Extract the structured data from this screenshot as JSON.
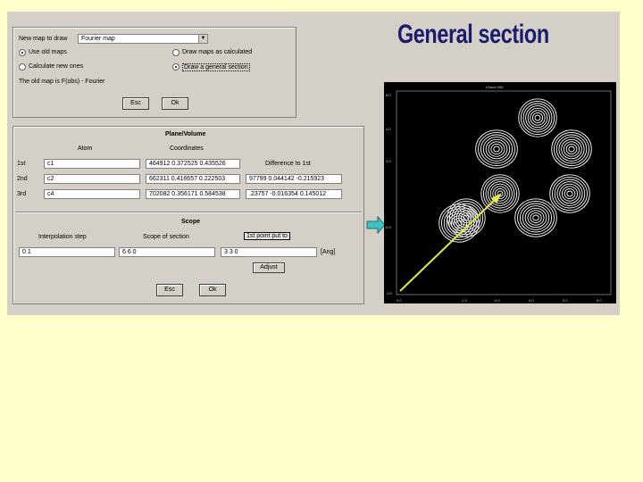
{
  "headline": "General section",
  "map_dialog": {
    "new_map_label": "New map to draw",
    "map_type_value": "Fourier map",
    "use_old_maps": "Use old maps",
    "draw_as_calculated": "Draw maps as calculated",
    "calculate_new": "Calculate new ones",
    "draw_general_section": "Draw a general section",
    "old_map_info": "The old map is F(obs) - Fourier",
    "esc_label": "Esc",
    "ok_label": "Ok"
  },
  "plane_dialog": {
    "title": "Plane/Volume",
    "atom_header": "Atom",
    "coord_header": "Coordinates",
    "diff_header": "Difference to 1st",
    "rows": [
      {
        "label": "1st",
        "atom": "c1",
        "coords": "464912 0.372525 0.435526",
        "diff": ""
      },
      {
        "label": "2nd",
        "atom": "c2",
        "coords": "662311 0.416657 0.222503",
        "diff": "97799 0.044142 -0.215923"
      },
      {
        "label": "3rd",
        "atom": "c4",
        "coords": "702082 0.356171 0.584538",
        "diff": ".23757 -0.016354 0.145012"
      }
    ],
    "scope_title": "Scope",
    "interp_label": "Interpolation step",
    "scope_label": "Scope of section",
    "first_point_label": "1st point put to",
    "interp_value": "0.1",
    "scope_value": "6 6 0",
    "first_point_value": "3 3 0",
    "unit_label": "[Ang]",
    "adjust_label": "Adjust",
    "esc_label": "Esc",
    "ok_label": "Ok"
  },
  "plot": {
    "title": "c2sect 260",
    "y_ticks": [
      "6.0",
      "4.0",
      "2.0",
      "0.0",
      "-2.0"
    ],
    "x_ticks": [
      "0.0",
      "-1.0",
      "0.0",
      "0.0",
      "0.0",
      "5.0"
    ]
  },
  "colors": {
    "slide_bg": "#ffffcc",
    "headline": "#1a1a6e",
    "arrow": "#40c0c0",
    "pointer": "#e8e840"
  }
}
